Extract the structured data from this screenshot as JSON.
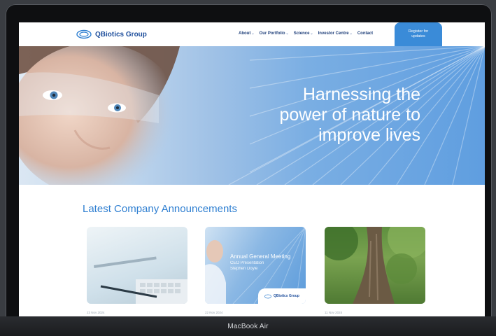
{
  "device": {
    "label": "MacBook Air"
  },
  "site": {
    "brand": "QBiotics Group",
    "nav": [
      "About",
      "Our Portfolio",
      "Science",
      "Investor Centre",
      "Contact"
    ],
    "cta": "Register for updates"
  },
  "hero": {
    "line1": "Harnessing the",
    "line2": "power of nature to",
    "line3": "improve lives"
  },
  "announcements": {
    "title": "Latest Company Announcements",
    "cards": [
      {
        "date": "23 Nov 2024"
      },
      {
        "overlay_title": "Annual General Meeting",
        "overlay_sub1": "CEO Presentation",
        "overlay_sub2": "Stephen Doyle",
        "badge": "QBiotics Group",
        "date": "22 Nov 2024"
      },
      {
        "date": "11 Nov 2024"
      }
    ]
  },
  "colors": {
    "brand": "#1f4f9c",
    "accent": "#3a8bd8",
    "heading": "#2f7fd1"
  }
}
